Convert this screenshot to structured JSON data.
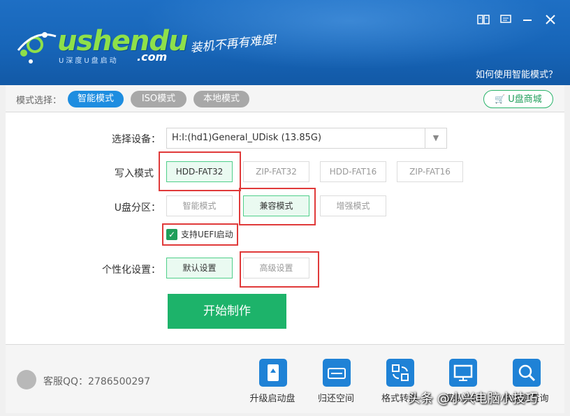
{
  "header": {
    "logo_text": "ushendu",
    "logo_sub": "U深度U盘启动",
    "logo_com": ".com",
    "slogan": "装机不再有难度!",
    "help_link": "如何使用智能模式？",
    "controls": [
      "book-icon",
      "message-icon",
      "minimize-icon",
      "close-icon"
    ]
  },
  "mode_bar": {
    "label": "模式选择：",
    "modes": [
      {
        "label": "智能模式",
        "active": true
      },
      {
        "label": "ISO模式",
        "active": false
      },
      {
        "label": "本地模式",
        "active": false
      }
    ],
    "shop": "U盘商城"
  },
  "form": {
    "device_label": "选择设备：",
    "device_value": "H:I:(hd1)General_UDisk (13.85G)",
    "write_label": "写入模式",
    "write_options": [
      "HDD-FAT32",
      "ZIP-FAT32",
      "HDD-FAT16",
      "ZIP-FAT16"
    ],
    "partition_label": "U盘分区：",
    "partition_options": [
      "智能模式",
      "兼容模式",
      "增强模式"
    ],
    "uefi_label": "支持UEFI启动",
    "personal_label": "个性化设置：",
    "personal_options": [
      "默认设置",
      "高级设置"
    ],
    "start_button": "开始制作"
  },
  "footer": {
    "qq_label": "客服QQ：2786500297",
    "tools": [
      "升级启动盘",
      "归还空间",
      "格式转换",
      "模拟启动",
      "快捷键查询"
    ]
  },
  "watermark": "头条 @小兴电脑小技巧",
  "colors": {
    "header": "#1765b8",
    "accent_blue": "#1e8de0",
    "green": "#1db36a",
    "highlight_red": "#e03a3a"
  }
}
